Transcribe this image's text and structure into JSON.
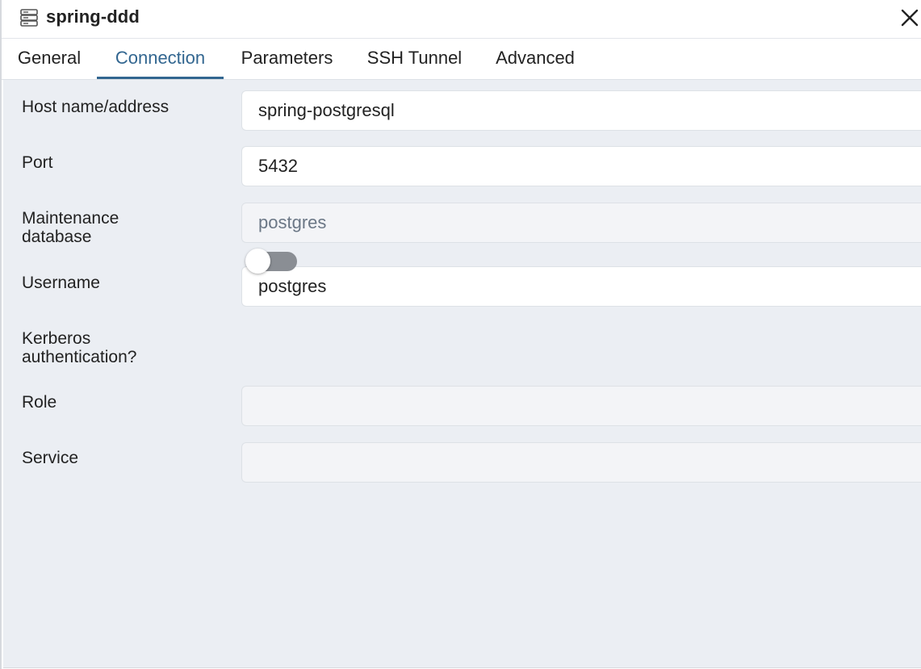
{
  "dialog": {
    "title": "spring-ddd",
    "title_icon": "server-icon",
    "close_icon": "close-icon"
  },
  "tabs": [
    {
      "label": "General",
      "active": false
    },
    {
      "label": "Connection",
      "active": true
    },
    {
      "label": "Parameters",
      "active": false
    },
    {
      "label": "SSH Tunnel",
      "active": false
    },
    {
      "label": "Advanced",
      "active": false
    }
  ],
  "form": {
    "host": {
      "label": "Host name/address",
      "value": "spring-postgresql"
    },
    "port": {
      "label": "Port",
      "value": "5432"
    },
    "maintenance_db": {
      "label": "Maintenance database",
      "value": "postgres",
      "disabled": true
    },
    "username": {
      "label": "Username",
      "value": "postgres"
    },
    "kerberos": {
      "label": "Kerberos authentication?",
      "enabled": false
    },
    "role": {
      "label": "Role",
      "value": ""
    },
    "service": {
      "label": "Service",
      "value": ""
    }
  },
  "colors": {
    "accent": "#326690",
    "content_bg": "#ebeef3",
    "toggle_off": "#8a8e94"
  }
}
